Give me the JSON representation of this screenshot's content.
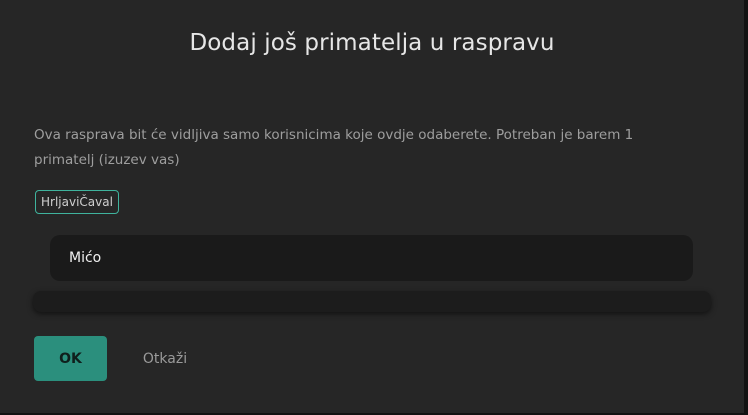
{
  "dialog": {
    "title": "Dodaj još primatelja u raspravu",
    "description": "Ova rasprava bit će vidljiva samo korisnicima koje ovdje odaberete. Potreban je barem 1 primatelj (izuzev vas)",
    "selected_recipients": [
      "HrljaviČaval"
    ],
    "search": {
      "value": "Mićo"
    },
    "buttons": {
      "ok_label": "OK",
      "cancel_label": "Otkaži"
    }
  },
  "colors": {
    "accent": "#2b8f7d",
    "chip_border": "#3fb39d",
    "dialog_background": "#262626",
    "input_background": "#1a1a1a"
  }
}
